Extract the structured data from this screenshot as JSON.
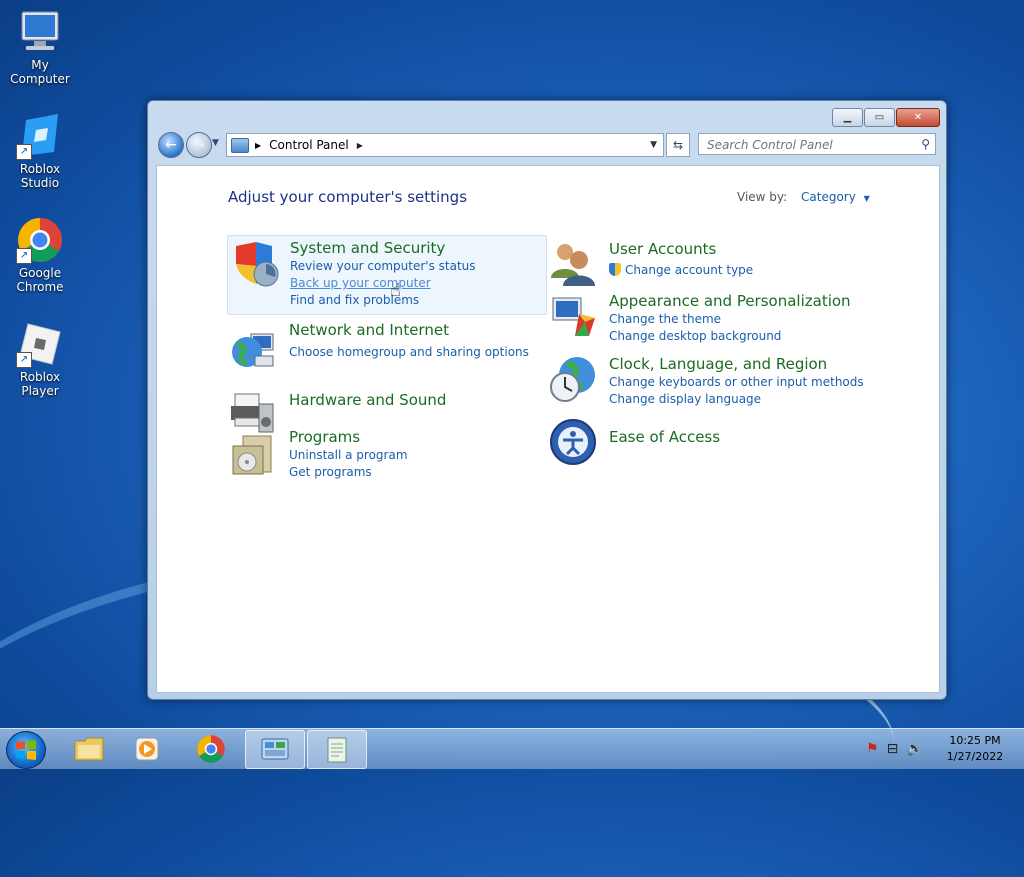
{
  "desktop": {
    "icons": [
      {
        "label": "My Computer"
      },
      {
        "label": "Roblox Studio"
      },
      {
        "label": "Google Chrome"
      },
      {
        "label": "Roblox Player"
      }
    ]
  },
  "window": {
    "address": {
      "crumb": "Control Panel"
    },
    "search": {
      "placeholder": "Search Control Panel"
    },
    "title": "Adjust your computer's settings",
    "view_by": {
      "label": "View by:",
      "value": "Category"
    },
    "categories": [
      {
        "title": "System and Security",
        "links": [
          "Review your computer's status",
          "Back up your computer",
          "Find and fix problems"
        ]
      },
      {
        "title": "Network and Internet",
        "links": [
          "Choose homegroup and sharing options"
        ]
      },
      {
        "title": "Hardware and Sound",
        "links": []
      },
      {
        "title": "Programs",
        "links": [
          "Uninstall a program",
          "Get programs"
        ]
      },
      {
        "title": "User Accounts",
        "links": [
          "Change account type"
        ]
      },
      {
        "title": "Appearance and Personalization",
        "links": [
          "Change the theme",
          "Change desktop background"
        ]
      },
      {
        "title": "Clock, Language, and Region",
        "links": [
          "Change keyboards or other input methods",
          "Change display language"
        ]
      },
      {
        "title": "Ease of Access",
        "links": []
      }
    ]
  },
  "taskbar": {
    "clock": {
      "time": "10:25 PM",
      "date": "1/27/2022"
    }
  }
}
